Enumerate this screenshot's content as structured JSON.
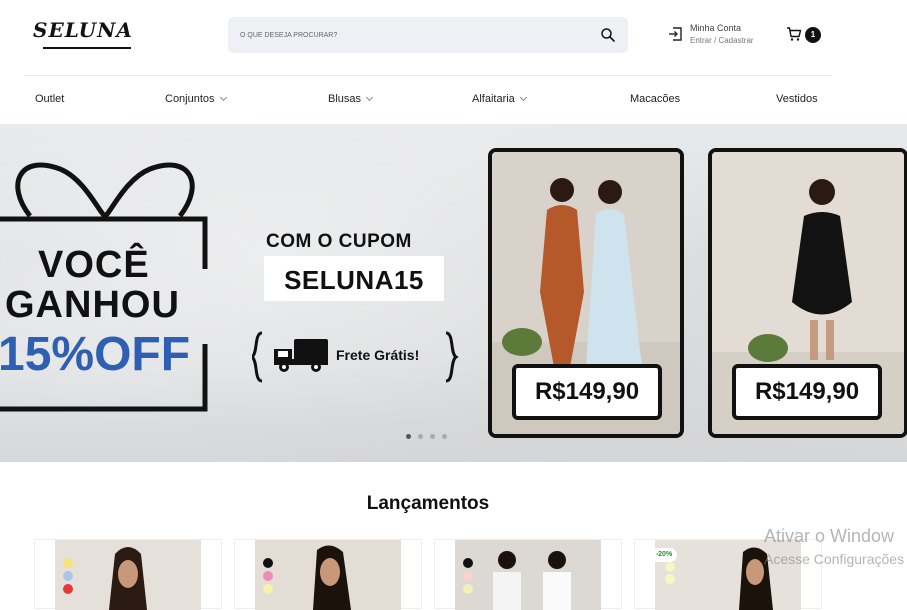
{
  "brand": {
    "logo_text": "SELUNA"
  },
  "search": {
    "placeholder": "O QUE DESEJA PROCURAR?"
  },
  "account": {
    "title": "Minha Conta",
    "subtitle": "Entrar / Cadastrar",
    "icon": "login-icon"
  },
  "cart": {
    "count": "1",
    "icon": "cart-icon"
  },
  "nav": {
    "items": [
      {
        "label": "Outlet",
        "has_dropdown": false
      },
      {
        "label": "Conjuntos",
        "has_dropdown": true
      },
      {
        "label": "Blusas",
        "has_dropdown": true
      },
      {
        "label": "Alfaitaria",
        "has_dropdown": true
      },
      {
        "label": "Macacões",
        "has_dropdown": false
      },
      {
        "label": "Vestidos",
        "has_dropdown": false
      }
    ]
  },
  "banner": {
    "line1": "VOCÊ",
    "line2": "GANHOU",
    "line3": "15%OFF",
    "coupon_label": "COM O CUPOM",
    "coupon_code": "SELUNA15",
    "shipping": "Frete Grátis!",
    "price_1": "R$149,90",
    "price_2": "R$149,90",
    "slides": 4,
    "active_slide": 1,
    "accent_color": "#2f5fb3"
  },
  "section": {
    "title": "Lançamentos"
  },
  "products": [
    {
      "swatches": [
        "#f4e27a",
        "#a9c6e4",
        "#e53935"
      ],
      "discount": ""
    },
    {
      "swatches": [
        "#111111",
        "#f08ab8",
        "#f5f3a6"
      ],
      "discount": ""
    },
    {
      "swatches": [
        "#111111",
        "#f7d2cf",
        "#f4f1b8"
      ],
      "discount": ""
    },
    {
      "swatches": [
        "#f7f7c4",
        "#f7f7c4"
      ],
      "discount": "-20%"
    }
  ],
  "watermark": {
    "line1": "Ativar o Window",
    "line2": "Acesse Configurações"
  }
}
